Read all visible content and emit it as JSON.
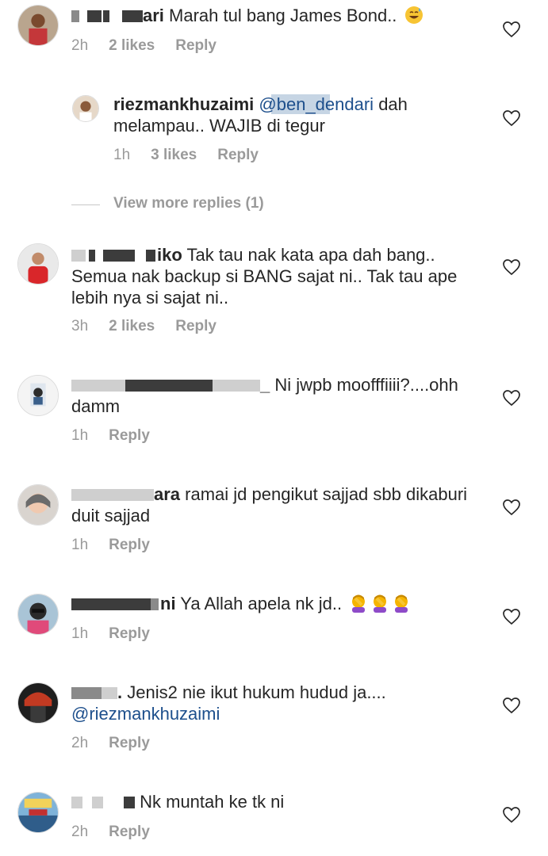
{
  "comments": [
    {
      "username_tail": "ari",
      "text": " Marah tul bang James Bond.. ",
      "time": "2h",
      "likes": "2 likes",
      "reply": "Reply"
    },
    {
      "username": "riezmankhuzaimi",
      "mention_visible": "@ben_dendari",
      "text": " dah melampau.. WAJIB di tegur",
      "time": "1h",
      "likes": "3 likes",
      "reply": "Reply"
    },
    {
      "username_tail": "iko",
      "text": " Tak tau nak kata apa dah bang.. Semua nak backup si BANG sajat ni.. Tak tau ape lebih nya si sajat ni..",
      "time": "3h",
      "likes": "2 likes",
      "reply": "Reply"
    },
    {
      "username_tail": "_",
      "text": " Ni jwpb moofffiiii?....ohh damm",
      "time": "1h",
      "reply": "Reply"
    },
    {
      "username_tail": "ara",
      "text": " ramai jd pengikut sajjad sbb dikaburi duit sajjad",
      "time": "1h",
      "reply": "Reply"
    },
    {
      "username_tail": "ni",
      "text": " Ya Allah apela nk jd.. ",
      "time": "1h",
      "reply": "Reply"
    },
    {
      "username_tail": ".",
      "text": " Jenis2 nie ikut hukum hudud ja....",
      "mention": "@riezmankhuzaimi",
      "time": "2h",
      "reply": "Reply"
    },
    {
      "text": " Nk muntah ke tk ni",
      "time": "2h",
      "reply": "Reply"
    }
  ],
  "view_more_replies": "View more replies (1)",
  "colors": {
    "text": "#262626",
    "meta": "#9a9a9a",
    "mention": "#1d4f8c"
  },
  "icons": {
    "like": "heart-outline-icon",
    "emoji1": "sweat-smile-emoji",
    "emoji2": "facepalm-emoji"
  }
}
